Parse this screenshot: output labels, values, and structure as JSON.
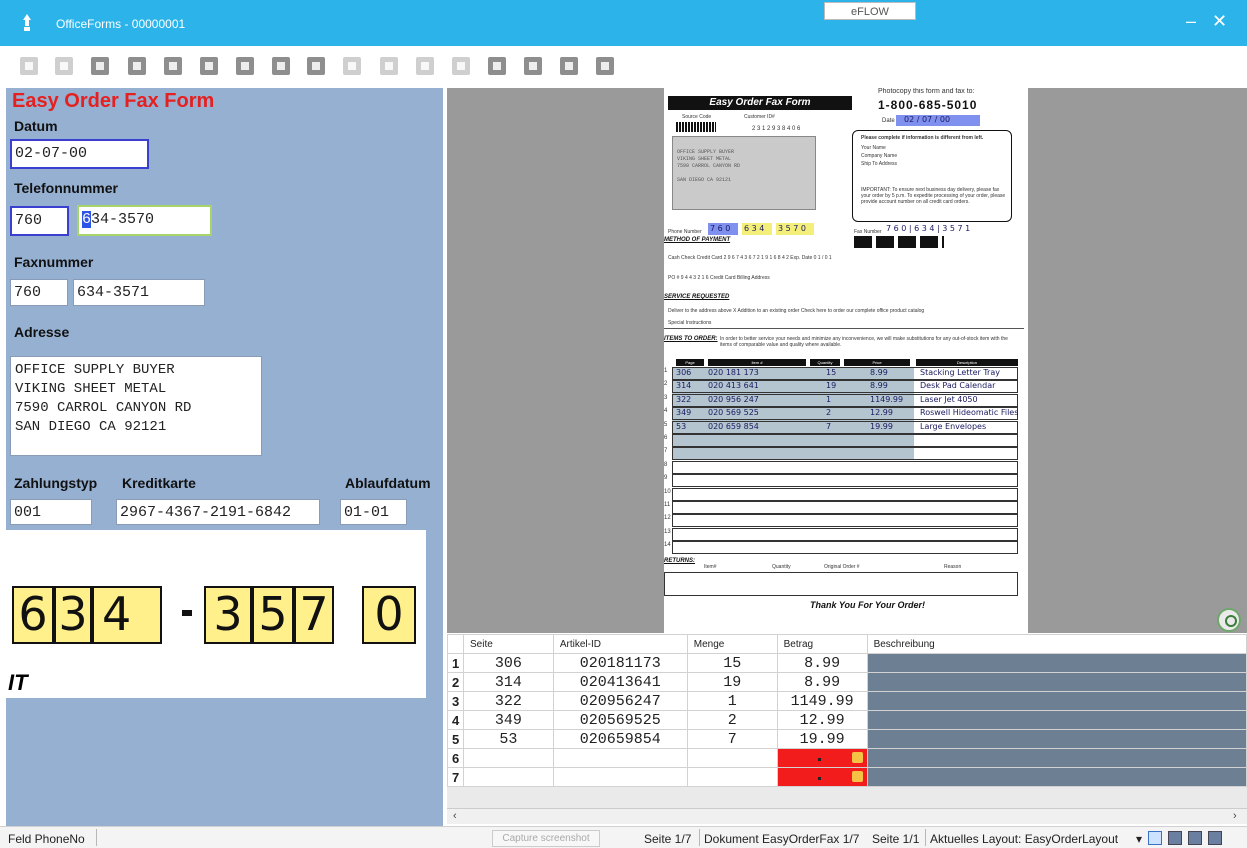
{
  "window": {
    "title": "OfficeForms - 00000001",
    "center_tab": "eFLOW",
    "minimize": "–",
    "close": "✕"
  },
  "form": {
    "title": "Easy Order Fax Form",
    "labels": {
      "datum": "Datum",
      "telefon": "Telefonnummer",
      "fax": "Faxnummer",
      "adresse": "Adresse",
      "zahlungstyp": "Zahlungstyp",
      "kreditkarte": "Kreditkarte",
      "ablaufdatum": "Ablaufdatum"
    },
    "values": {
      "datum": "02-07-00",
      "telefon_area": "760",
      "telefon_caret": "6",
      "telefon_rest": "34-3570",
      "fax_area": "760",
      "fax_number": "634-3571",
      "adresse": "OFFICE SUPPLY BUYER\nVIKING SHEET METAL\n7590 CARROL CANYON RD\nSAN DIEGO CA 92121",
      "zahlungstyp": "001",
      "kreditkarte": "2967-4367-2191-6842",
      "ablaufdatum": "01-01"
    }
  },
  "snippet": {
    "digits": [
      "6",
      "3",
      "4",
      "3",
      "5",
      "7",
      "0"
    ],
    "cut_text": "IT"
  },
  "document": {
    "title": "Easy Order Fax Form",
    "copy_text": "Photocopy this form and fax to:",
    "phone": "1-800-685-5010",
    "source_code": "Source Code",
    "customer_id": "Customer ID#",
    "customer_id_value": "2 3 1 2 9 3 8 4 0 6",
    "date_label": "Date",
    "date_value": "02 / 07 / 00",
    "address_block": "OFFICE SUPPLY BUYER\nVIKING SHEET METAL\n7590 CARROL CANYON RD\n\nSAN DIEGO CA 92121",
    "right_box_title": "Please complete if information is different from left.",
    "right_box_lines": [
      "Your Name",
      "Company Name",
      "Ship To Address"
    ],
    "important_note": "IMPORTANT: To ensure next business day delivery, please fax your order by 5 p.m. To expedite processing of your order, please provide account number on all credit card orders.",
    "phone_label": "Phone Number",
    "phone_area": "7 6 0",
    "phone_mid": "6 3 4",
    "phone_last": "3 5 7 0",
    "fax_label": "Fax Number",
    "fax_digits": "7 6 0 | 6 3 4 | 3 5 7 1",
    "method": "METHOD OF PAYMENT",
    "payment_line": "Cash   Check   Credit Card 2 9 6 7 4 3 6 7 2 1 9 1 6 8 4 2   Exp. Date 0 1 / 0 1",
    "po_line": "PO #   9 4 4 3 2 1 6   Credit Card Billing Address",
    "service": "SERVICE REQUESTED",
    "service_line": "Deliver to the address above   X Addition to an existing order   Check here to order our complete office product catalog",
    "special": "Special Instructions",
    "items": "ITEMS TO ORDER:",
    "items_note": "In order to better service your needs and minimize any inconvenience, we will make substitutions for any out-of-stock item with the items of comparable value and quality where available.",
    "grid_headers": [
      "Page",
      "Item #",
      "Quantity",
      "Price",
      "Description"
    ],
    "hw_rows": [
      {
        "n": "1",
        "page": "306",
        "item": "020 181 173",
        "qty": "15",
        "price": "8.99",
        "desc": "Stacking Letter Tray"
      },
      {
        "n": "2",
        "page": "314",
        "item": "020 413 641",
        "qty": "19",
        "price": "8.99",
        "desc": "Desk Pad Calendar"
      },
      {
        "n": "3",
        "page": "322",
        "item": "020 956 247",
        "qty": "1",
        "price": "1149.99",
        "desc": "Laser Jet 4050"
      },
      {
        "n": "4",
        "page": "349",
        "item": "020 569 525",
        "qty": "2",
        "price": "12.99",
        "desc": "Roswell Hideomatic Files"
      },
      {
        "n": "5",
        "page": "53",
        "item": "020 659 854",
        "qty": "7",
        "price": "19.99",
        "desc": "Large Envelopes"
      }
    ],
    "row_numbers": [
      "6",
      "7",
      "8",
      "9",
      "10",
      "11",
      "12",
      "13",
      "14"
    ],
    "returns": "RETURNS:",
    "returns_cols": [
      "Item#",
      "Quantity",
      "Original Order #",
      "Reason"
    ],
    "thanks": "Thank You For Your Order!"
  },
  "table": {
    "headers": [
      "Seite",
      "Artikel-ID",
      "Menge",
      "Betrag",
      "Beschreibung"
    ],
    "rows": [
      {
        "n": "1",
        "seite": "306",
        "artikel": "020181173",
        "menge": "15",
        "betrag": "8.99"
      },
      {
        "n": "2",
        "seite": "314",
        "artikel": "020413641",
        "menge": "19",
        "betrag": "8.99"
      },
      {
        "n": "3",
        "seite": "322",
        "artikel": "020956247",
        "menge": "1",
        "betrag": "1149.99"
      },
      {
        "n": "4",
        "seite": "349",
        "artikel": "020569525",
        "menge": "2",
        "betrag": "12.99"
      },
      {
        "n": "5",
        "seite": "53",
        "artikel": "020659854",
        "menge": "7",
        "betrag": "19.99"
      },
      {
        "n": "6",
        "seite": "",
        "artikel": "",
        "menge": "",
        "betrag": ""
      },
      {
        "n": "7",
        "seite": "",
        "artikel": "",
        "menge": "",
        "betrag": ""
      }
    ]
  },
  "status": {
    "field": "Feld PhoneNo",
    "capture": "Capture screenshot",
    "seite": "Seite 1/7",
    "dokument": "Dokument EasyOrderFax 1/7",
    "seite2": "Seite 1/1",
    "layout": "Aktuelles Layout: EasyOrderLayout",
    "dropdown_arrow": "▾"
  },
  "colors": {
    "titlebar": "#2cb4ea",
    "form_panel": "#96b0d2",
    "form_title": "#e52020",
    "error_cell": "#f31c1c",
    "desc_cell": "#6d7f93"
  }
}
